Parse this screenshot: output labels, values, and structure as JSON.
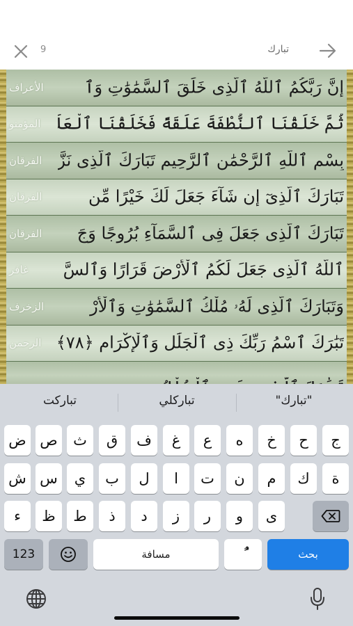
{
  "header": {
    "result_count": "9",
    "query": "تبارك",
    "icons": {
      "close": "close-icon",
      "navigate": "arrow-right-icon"
    }
  },
  "results": [
    {
      "surah": "الأعراف",
      "verse": "إِنَّ رَبَّكُمُ ٱللَّهُ ٱلَّذِى خَلَقَ ٱلسَّمَٰوَٰتِ وَٱ"
    },
    {
      "surah": "المؤمنو",
      "verse": "ثُمَّ خَلَقْنَا ٱلنُّطْفَةَ عَلَقَةً فَخَلَقْنَا ٱلْعَلَقَةَ"
    },
    {
      "surah": "الفرقان",
      "verse": "بِسْمِ ٱللَّهِ ٱلرَّحْمَٰنِ ٱلرَّحِيمِ تَبَارَكَ ٱلَّذِى نَزَّ"
    },
    {
      "surah": "الفرقان",
      "verse": "تَبَارَكَ ٱلَّذِىٓ إِن شَآءَ جَعَلَ لَكَ خَيْرًا مِّن"
    },
    {
      "surah": "الفرقان",
      "verse": "تَبَارَكَ ٱلَّذِى جَعَلَ فِى ٱلسَّمَآءِ بُرُوجًا وَجَ"
    },
    {
      "surah": "غافر",
      "verse": "ٱللَّهُ ٱلَّذِى جَعَلَ لَكُمُ ٱلْأَرْضَ قَرَارًا وَٱلسَّ"
    },
    {
      "surah": "الزخرف",
      "verse": "وَتَبَارَكَ ٱلَّذِى لَهُۥ مُلْكُ ٱلسَّمَٰوَٰتِ وَٱلْأَرْ"
    },
    {
      "surah": "الرحمن",
      "verse": "تَبَٰرَكَ ٱسْمُ رَبِّكَ ذِى ٱلْجَلَٰلِ وَٱلْإِكْرَامِ ﴿٧٨﴾"
    },
    {
      "surah": "",
      "verse": "تَبَٰرَكَ ٱلَّذِى بِيَدِهِ ٱلْمُلْكُ"
    }
  ],
  "keyboard": {
    "suggestions": [
      "\"تبارك\"",
      "تباركلي",
      "تباركت"
    ],
    "row1": [
      "ج",
      "ح",
      "خ",
      "ه",
      "ع",
      "غ",
      "ف",
      "ق",
      "ث",
      "ص",
      "ض"
    ],
    "row2": [
      "ة",
      "ك",
      "م",
      "ن",
      "ت",
      "ا",
      "ل",
      "ب",
      "ي",
      "س",
      "ش"
    ],
    "row3": [
      "ى",
      "و",
      "ر",
      "ز",
      "د",
      "ذ",
      "ط",
      "ظ",
      "ء"
    ],
    "numbers_key": "123",
    "space_key": "مسافة",
    "diacritic_key": "ًُ",
    "search_key": "بحث",
    "icons": {
      "emoji": "emoji-icon",
      "backspace": "backspace-icon",
      "globe": "globe-icon",
      "mic": "microphone-icon"
    }
  },
  "colors": {
    "accent": "#1f7fe6",
    "results_background": "#5f7a55",
    "keyboard_background": "#d3d7dd"
  }
}
